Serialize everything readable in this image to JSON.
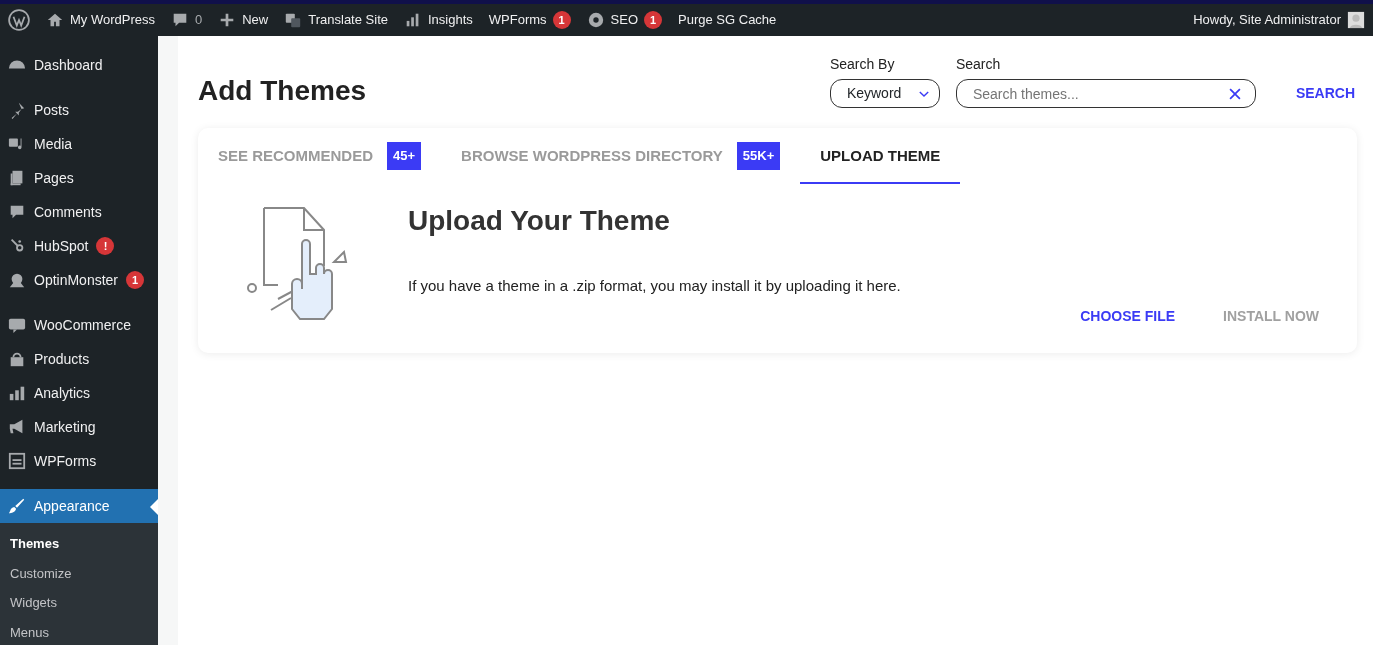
{
  "admin_bar": {
    "items": [
      {
        "kind": "logo"
      },
      {
        "kind": "site",
        "label": "My WordPress"
      },
      {
        "kind": "comments",
        "label": "0"
      },
      {
        "kind": "new",
        "label": "New"
      },
      {
        "kind": "translate",
        "label": "Translate Site"
      },
      {
        "kind": "insights",
        "label": "Insights"
      },
      {
        "kind": "plain",
        "label": "WPForms",
        "badge": "1"
      },
      {
        "kind": "seo",
        "label": "SEO",
        "badge": "1"
      },
      {
        "kind": "plain",
        "label": "Purge SG Cache"
      }
    ],
    "account": "Howdy, Site Administrator"
  },
  "sidebar": {
    "groups": [
      {
        "items": [
          {
            "label": "Dashboard",
            "selected": false
          }
        ]
      },
      {
        "items": [
          {
            "label": "Posts",
            "selected": false
          },
          {
            "label": "Media",
            "selected": false
          },
          {
            "label": "Pages",
            "selected": false
          },
          {
            "label": "Comments",
            "selected": false
          },
          {
            "label": "HubSpot",
            "selected": false,
            "badge": "!"
          },
          {
            "label": "OptinMonster",
            "selected": false,
            "badge": "1"
          }
        ]
      },
      {
        "items": [
          {
            "label": "WooCommerce",
            "selected": false
          },
          {
            "label": "Products",
            "selected": false
          },
          {
            "label": "Analytics",
            "selected": false
          },
          {
            "label": "Marketing",
            "selected": false
          },
          {
            "label": "WPForms",
            "selected": false
          }
        ]
      },
      {
        "items": [
          {
            "label": "Appearance",
            "selected": true,
            "children": [
              {
                "label": "Themes",
                "selected": true
              },
              {
                "label": "Customize",
                "selected": false
              },
              {
                "label": "Widgets",
                "selected": false
              },
              {
                "label": "Menus",
                "selected": false
              }
            ]
          }
        ]
      }
    ]
  },
  "page": {
    "title": "Add Themes",
    "search_by": {
      "label": "Search By",
      "value": "Keyword"
    },
    "search": {
      "label": "Search",
      "placeholder": "Search themes..."
    },
    "search_button": "SEARCH",
    "tabs": [
      {
        "label": "SEE RECOMMENDED",
        "badge": "45+",
        "selected": false
      },
      {
        "label": "BROWSE WORDPRESS DIRECTORY",
        "badge": "55K+",
        "selected": false
      },
      {
        "label": "UPLOAD THEME",
        "selected": true
      }
    ],
    "upload": {
      "heading": "Upload Your Theme",
      "text": "If you have a theme in a .zip format, you may install it by uploading it here.",
      "choose_file": "CHOOSE FILE",
      "install_now": {
        "label": "INSTALL NOW",
        "disabled": true
      }
    }
  }
}
